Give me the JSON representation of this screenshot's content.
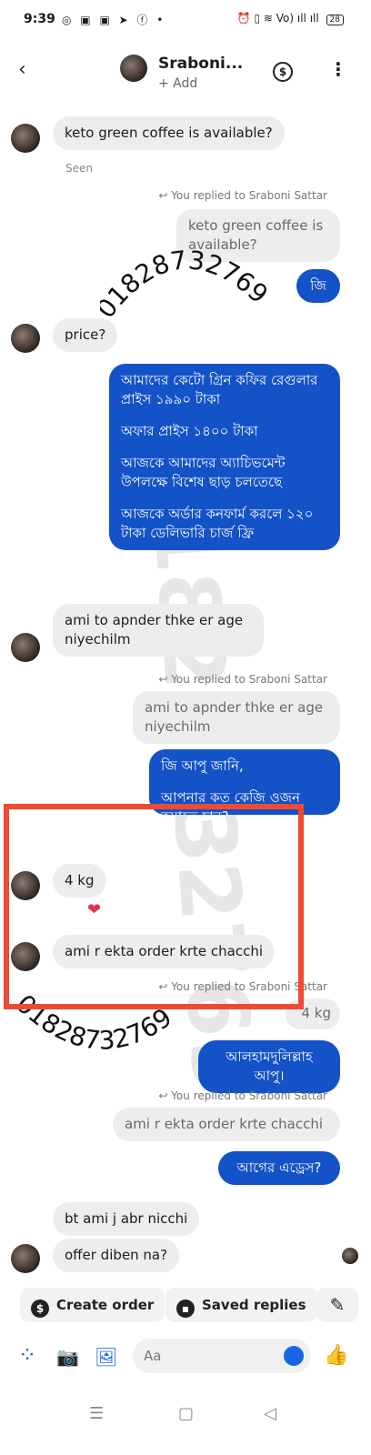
{
  "status_bar": {
    "time": "9:39",
    "left_icons": "◎ ▣ ▣ ➤ ⓕ •",
    "right_icons": "⏰ ▯ ≋ Vo) ıll ıll",
    "battery": "28"
  },
  "header": {
    "contact_name": "Sraboni...",
    "sub_label": "+ Add",
    "back_icon": "‹",
    "dollar_icon": "$",
    "menu_icon": "⋮"
  },
  "messages": {
    "m1": "keto green coffee is available?",
    "seen": "Seen",
    "reply1_note": "↩ You replied to Sraboni Sattar",
    "reply1_quote": "keto green coffee is available?",
    "reply1_text": "জি",
    "m2": "price?",
    "offer_p1": "আমাদের কেটো গ্রিন কফির রেগুলার প্রাইস ১৯৯০ টাকা",
    "offer_p2": "অফার প্রাইস ১৪০০ টাকা",
    "offer_p3": "আজকে আমাদের অ্যাচিভমেন্ট উপলক্ষে বিশেষ ছাড় চলতেছে",
    "offer_p4": "আজকে অর্ডার কনফার্ম করলে ১২০ টাকা ডেলিভারি চার্জ ফ্রি",
    "m3": "ami to apnder thke er age niyechilm",
    "reply2_note": "↩ You replied to Sraboni Sattar",
    "reply2_quote": "ami to apnder thke er age niyechilm",
    "reply2_p1": "জি আপু জানি,",
    "reply2_p2": "আপনার কত কেজি ওজন কমাতে চান?",
    "m4": "4 kg",
    "m5": "ami r ekta order krte chacchi",
    "reply3_note": "↩ You replied to Sraboni Sattar",
    "reply3_quote": "4 kg",
    "reply3_text": "আলহামদুলিল্লাহ আপু।",
    "reply4_note": "↩ You replied to Sraboni Sattar",
    "reply4_quote": "ami r ekta order krte chacchi",
    "reply4_text": "আগের এড্রেস?",
    "m6": "bt ami j abr nicchi",
    "m7": "offer diben na?"
  },
  "watermark": {
    "phone": "01828732769",
    "ghost": "01828732769"
  },
  "reaction": "❤",
  "quick_actions": {
    "create_order": "Create order",
    "saved_replies": "Saved replies",
    "edit_icon": "✎"
  },
  "composer": {
    "placeholder": "Aa",
    "apps_icon": "⁘",
    "camera_icon": "📷",
    "gallery_icon": "🖼",
    "like_icon": "👍"
  },
  "nav": {
    "menu_icon": "☰",
    "home_icon": "▢",
    "back_icon": "◁"
  },
  "colors": {
    "outgoing_bubble": "#1452c8",
    "incoming_bubble": "#ededed",
    "highlight_box": "#f04a30",
    "accent": "#1866e8"
  }
}
